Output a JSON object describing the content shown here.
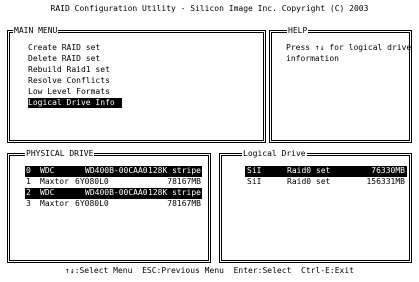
{
  "app": {
    "title": "RAID Configuration Utility - Silicon Image Inc. Copyright (C) 2003"
  },
  "main_menu": {
    "title": "MAIN MENU",
    "items": [
      {
        "label": "Create RAID set",
        "selected": false
      },
      {
        "label": "Delete RAID set",
        "selected": false
      },
      {
        "label": "Rebuild Raid1 set",
        "selected": false
      },
      {
        "label": "Resolve Conflicts",
        "selected": false
      },
      {
        "label": "Low Level Formats",
        "selected": false
      },
      {
        "label": "Logical Drive Info",
        "selected": true
      }
    ]
  },
  "help": {
    "title": "HELP",
    "line1_pre": "Press ",
    "arrows": "↑↓",
    "line1_post": " for logical drive",
    "line2": "information"
  },
  "physical_drive": {
    "title": "PHYSICAL DRIVE",
    "rows": [
      {
        "index": "0",
        "vendor": "WDC",
        "model": "WD400B-00CAA0",
        "info": "128K stripe",
        "selected": true
      },
      {
        "index": "1",
        "vendor": "Maxtor",
        "model": "6Y080L0",
        "info": "78167MB",
        "selected": false
      },
      {
        "index": "2",
        "vendor": "WDC",
        "model": "WD400B-00CAA0",
        "info": "128K stripe",
        "selected": true
      },
      {
        "index": "3",
        "vendor": "Maxtor",
        "model": "6Y080L0",
        "info": "78167MB",
        "selected": false
      }
    ]
  },
  "logical_drive": {
    "title": "Logical Drive",
    "rows": [
      {
        "vendor": "SiI",
        "set": "Raid0 set",
        "size": "76330MB",
        "selected": true
      },
      {
        "vendor": "SiI",
        "set": "Raid0 set",
        "size": "156331MB",
        "selected": false
      }
    ]
  },
  "status_bar": {
    "arrows": "↑↓",
    "text": ":Select Menu  ESC:Previous Menu  Enter:Select  Ctrl-E:Exit"
  }
}
